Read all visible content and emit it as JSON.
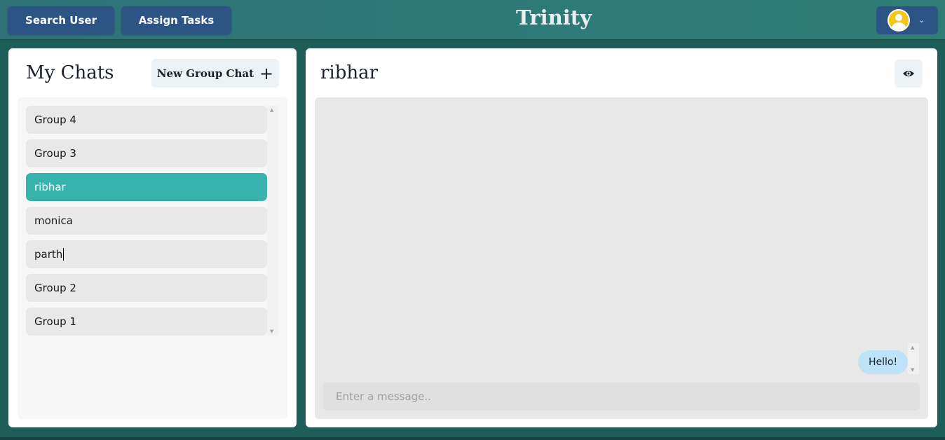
{
  "header": {
    "search_user_label": "Search User",
    "assign_tasks_label": "Assign Tasks",
    "brand": "Trinity",
    "profile_menu_icon": "chevron-down-icon"
  },
  "sidebar": {
    "title": "My Chats",
    "new_group_label": "New Group Chat",
    "chats": [
      {
        "label": "Group 4",
        "active": false
      },
      {
        "label": "Group 3",
        "active": false
      },
      {
        "label": "ribhar",
        "active": true
      },
      {
        "label": "monica",
        "active": false
      },
      {
        "label": "parth",
        "active": false
      },
      {
        "label": "Group 2",
        "active": false
      },
      {
        "label": "Group 1",
        "active": false
      }
    ]
  },
  "conversation": {
    "title": "ribhar",
    "view_profile_icon": "eye-icon",
    "messages": [
      {
        "text": "Hello!",
        "own": true
      }
    ],
    "input_placeholder": "Enter a message.."
  },
  "colors": {
    "header_bg": "#2e7278",
    "button_bg": "#2c5485",
    "active_chat": "#38b2ac",
    "bubble_own": "#bee3f8",
    "page_bg": "#1d5e58"
  }
}
